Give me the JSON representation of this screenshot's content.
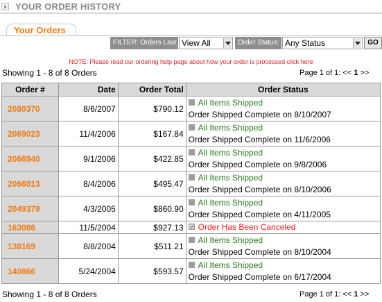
{
  "header": {
    "title": "YOUR ORDER HISTORY"
  },
  "tab": {
    "label": "Your Orders"
  },
  "filter": {
    "orders_last_label": "FILTER: Orders Last",
    "orders_last_value": "View All",
    "status_label": "Order Status:",
    "status_value": "Any Status",
    "go_label": "GO"
  },
  "note": "NOTE: Please read our ordering help page about how your order is processed click here",
  "summary": {
    "showing": "Showing 1 - 8 of 8 Orders",
    "pager_prefix": "Page 1 of 1:",
    "prev": "<<",
    "page": "1",
    "next": ">>"
  },
  "columns": [
    "Order #",
    "Date",
    "Order Total",
    "Order Status"
  ],
  "orders": [
    {
      "id": "2080370",
      "date": "8/6/2007",
      "total": "$790.12",
      "status": "All Items Shipped",
      "detail": "Order Shipped Complete on 8/10/2007"
    },
    {
      "id": "2069023",
      "date": "11/4/2006",
      "total": "$167.84",
      "status": "All Items Shipped",
      "detail": "Order Shipped Complete on 11/6/2006"
    },
    {
      "id": "2066940",
      "date": "9/1/2006",
      "total": "$422.85",
      "status": "All Items Shipped",
      "detail": "Order Shipped Complete on 9/8/2006"
    },
    {
      "id": "2066013",
      "date": "8/4/2006",
      "total": "$495.47",
      "status": "All Items Shipped",
      "detail": "Order Shipped Complete on 8/10/2006"
    },
    {
      "id": "2049379",
      "date": "4/3/2005",
      "total": "$860.90",
      "status": "All Items Shipped",
      "detail": "Order Shipped Complete on 4/11/2005"
    },
    {
      "id": "163086",
      "date": "11/5/2004",
      "total": "$927.13",
      "status": "Order Has Been Canceled",
      "detail": ""
    },
    {
      "id": "138169",
      "date": "8/8/2004",
      "total": "$511.21",
      "status": "All Items Shipped",
      "detail": "Order Shipped Complete on 8/10/2004"
    },
    {
      "id": "140866",
      "date": "5/24/2004",
      "total": "$593.57",
      "status": "All Items Shipped",
      "detail": "Order Shipped Complete on 6/17/2004"
    }
  ],
  "colors": {
    "accent": "#f07c16",
    "shipped": "#2a7a1f",
    "canceled": "#ee1c1c",
    "header_bg": "#d9d9d9"
  }
}
